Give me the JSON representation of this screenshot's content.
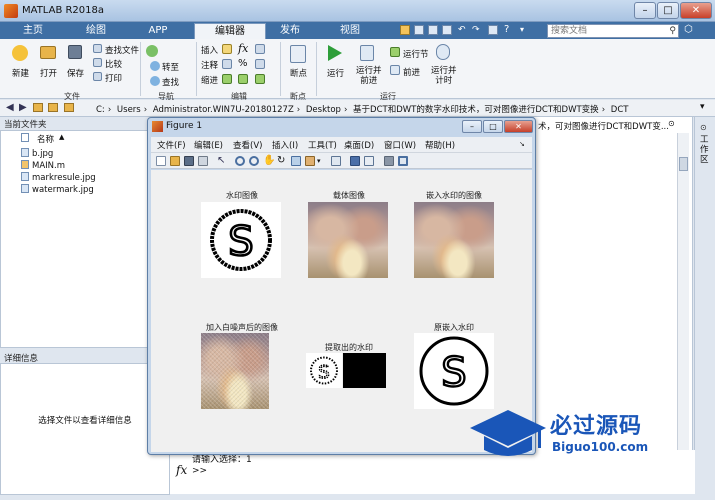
{
  "app": {
    "title": "MATLAB R2018a"
  },
  "main_tabs": [
    "主页",
    "绘图",
    "APP",
    "编辑器",
    "发布",
    "视图"
  ],
  "active_tab": "编辑器",
  "search": {
    "placeholder": "搜索文档"
  },
  "ribbon": {
    "file": {
      "label": "文件",
      "new": "新建",
      "open": "打开",
      "save": "保存",
      "find_files": "查找文件",
      "compare": "比较",
      "print": "打印"
    },
    "navigate": {
      "label": "导航",
      "goto": "转至",
      "find": "查找"
    },
    "edit": {
      "label": "编辑",
      "insert": "插入",
      "comment": "注释",
      "indent": "缩进",
      "fx": "fx"
    },
    "breakpoints": {
      "label": "断点",
      "breakpoints": "断点"
    },
    "run": {
      "label": "运行",
      "run": "运行",
      "run_advance": "运行并\n前进",
      "run_section": "运行节",
      "advance": "前进",
      "run_time": "运行并\n计时"
    }
  },
  "path": [
    "C:",
    "Users",
    "Administrator.WIN7U-20180127Z",
    "Desktop",
    "基于DCT和DWT的数字水印技术，可对图像进行DCT和DWT变换",
    "DCT"
  ],
  "current_folder": {
    "header": "当前文件夹",
    "column_name": "名称",
    "files": [
      "b.jpg",
      "MAIN.m",
      "markresule.jpg",
      "watermark.jpg"
    ]
  },
  "details": {
    "header": "详细信息",
    "hint": "选择文件以查看详细信息"
  },
  "right_pane": {
    "overflow_path": "术，可对图像进行DCT和DWT变...",
    "side_tab": "工作区"
  },
  "command": {
    "prompt_text": "请输入选择：1",
    "fx": "fx",
    "cursor": ">>"
  },
  "figure": {
    "title": "Figure 1",
    "menu": [
      "文件(F)",
      "编辑(E)",
      "查看(V)",
      "插入(I)",
      "工具(T)",
      "桌面(D)",
      "窗口(W)",
      "帮助(H)"
    ],
    "captions": [
      "水印图像",
      "载体图像",
      "嵌入水印的图像",
      "加入白噪声后的图像",
      "提取出的水印",
      "原嵌入水印"
    ]
  },
  "brand": {
    "title": "必过源码",
    "url": "Biguo100.com"
  },
  "colors": {
    "tab_bar": "#3f6fa4",
    "brand_blue": "#1a56b8"
  }
}
